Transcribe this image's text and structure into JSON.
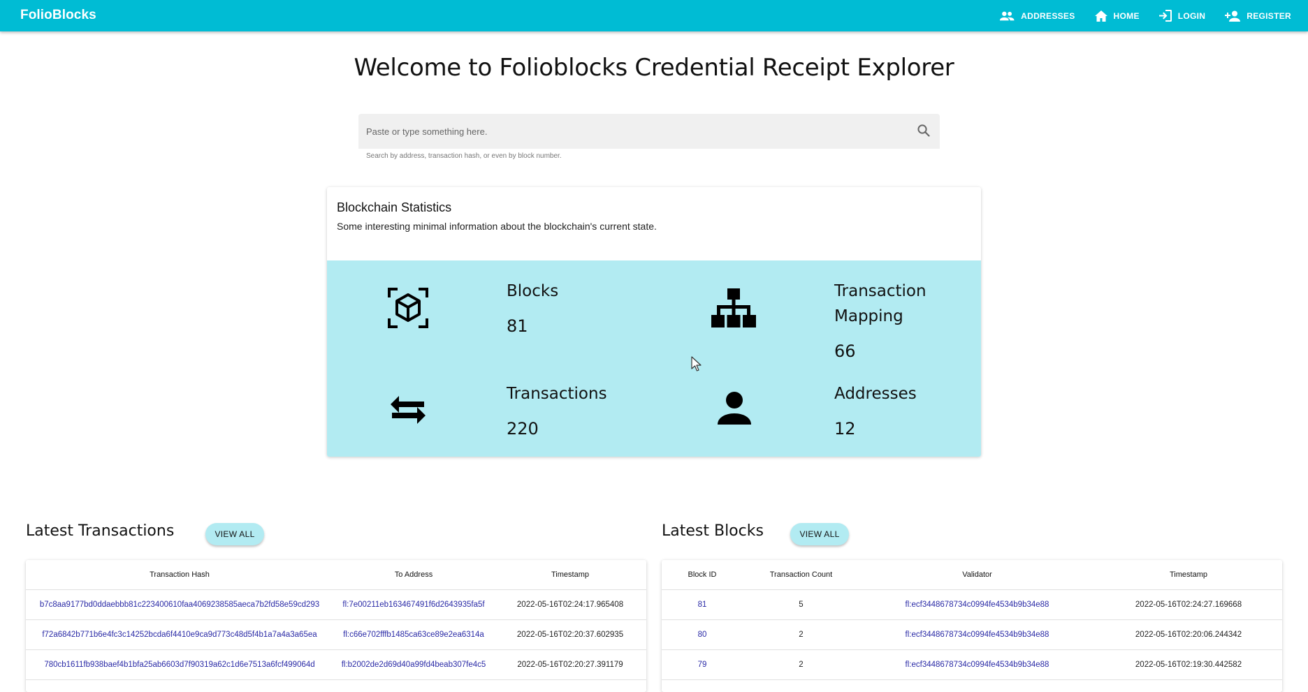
{
  "app": {
    "brand": "FolioBlocks"
  },
  "nav": [
    {
      "label": "ADDRESSES",
      "icon": "people-icon"
    },
    {
      "label": "HOME",
      "icon": "home-icon"
    },
    {
      "label": "LOGIN",
      "icon": "login-icon"
    },
    {
      "label": "REGISTER",
      "icon": "person-add-icon"
    }
  ],
  "hero": {
    "title": "Welcome to Folioblocks Credential Receipt Explorer",
    "search_placeholder": "Paste or type something here.",
    "search_help": "Search by address, transaction hash, or even by block number."
  },
  "stats": {
    "title": "Blockchain Statistics",
    "subtitle": "Some interesting minimal information about the blockchain's current state.",
    "items": [
      {
        "label": "Blocks",
        "value": "81",
        "icon": "cube-scan-icon"
      },
      {
        "label": "Transaction Mapping",
        "value": "66",
        "icon": "hierarchy-icon"
      },
      {
        "label": "Transactions",
        "value": "220",
        "icon": "swap-arrows-icon"
      },
      {
        "label": "Addresses",
        "value": "12",
        "icon": "person-icon"
      }
    ]
  },
  "latest_transactions": {
    "title": "Latest Transactions",
    "view_all": "VIEW ALL",
    "columns": [
      "Transaction Hash",
      "To Address",
      "Timestamp"
    ],
    "rows": [
      [
        "b7c8aa9177bd0ddaebbb81c223400610faa4069238585aeca7b2fd58e59cd293",
        "fl:7e00211eb163467491f6d2643935fa5f",
        "2022-05-16T02:24:17.965408"
      ],
      [
        "f72a6842b771b6e4fc3c14252bcda6f4410e9ca9d773c48d5f4b1a7a4a3a65ea",
        "fl:c66e702fffb1485ca63ce89e2ea6314a",
        "2022-05-16T02:20:37.602935"
      ],
      [
        "780cb1611fb938baef4b1bfa25ab6603d7f90319a62c1d6e7513a6fcf499064d",
        "fl:b2002de2d69d40a99fd4beab307fe4c5",
        "2022-05-16T02:20:27.391179"
      ]
    ]
  },
  "latest_blocks": {
    "title": "Latest Blocks",
    "view_all": "VIEW ALL",
    "columns": [
      "Block ID",
      "Transaction Count",
      "Validator",
      "Timestamp"
    ],
    "rows": [
      [
        "81",
        "5",
        "fl:ecf3448678734c0994fe4534b9b34e88",
        "2022-05-16T02:24:27.169668"
      ],
      [
        "80",
        "2",
        "fl:ecf3448678734c0994fe4534b9b34e88",
        "2022-05-16T02:20:06.244342"
      ],
      [
        "79",
        "2",
        "fl:ecf3448678734c0994fe4534b9b34e88",
        "2022-05-16T02:19:30.442582"
      ]
    ]
  }
}
